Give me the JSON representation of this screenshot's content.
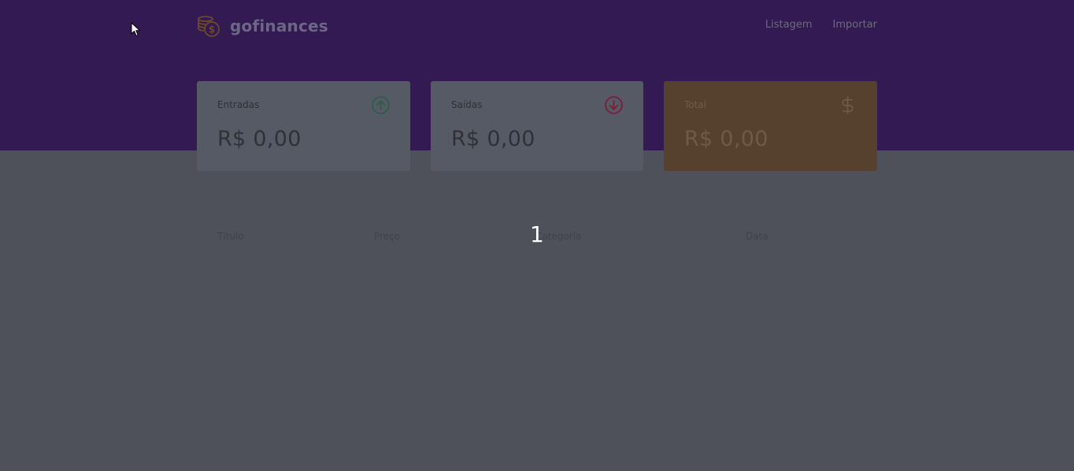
{
  "app": {
    "name": "gofinances",
    "logo_icon": "coins-dollar-icon"
  },
  "nav": {
    "items": [
      "Listagem",
      "Importar"
    ]
  },
  "cards": {
    "income": {
      "label": "Entradas",
      "value": "R$ 0,00",
      "icon": "arrow-up-circle-icon",
      "icon_color": "#2e5e47"
    },
    "outcome": {
      "label": "Saídas",
      "value": "R$ 0,00",
      "icon": "arrow-down-circle-icon",
      "icon_color": "#7a1e3a"
    },
    "total": {
      "label": "Total",
      "value": "R$ 0,00",
      "icon": "dollar-sign-icon",
      "icon_color": "#6d5b48"
    }
  },
  "table": {
    "columns": [
      "Título",
      "Preço",
      "Categoria",
      "Data"
    ],
    "rows": []
  },
  "overlay": {
    "label": "1"
  },
  "colors": {
    "header_bg": "#341a53",
    "page_bg": "#4e505a",
    "card_bg": "#565a64",
    "total_card_bg": "#56412f"
  }
}
